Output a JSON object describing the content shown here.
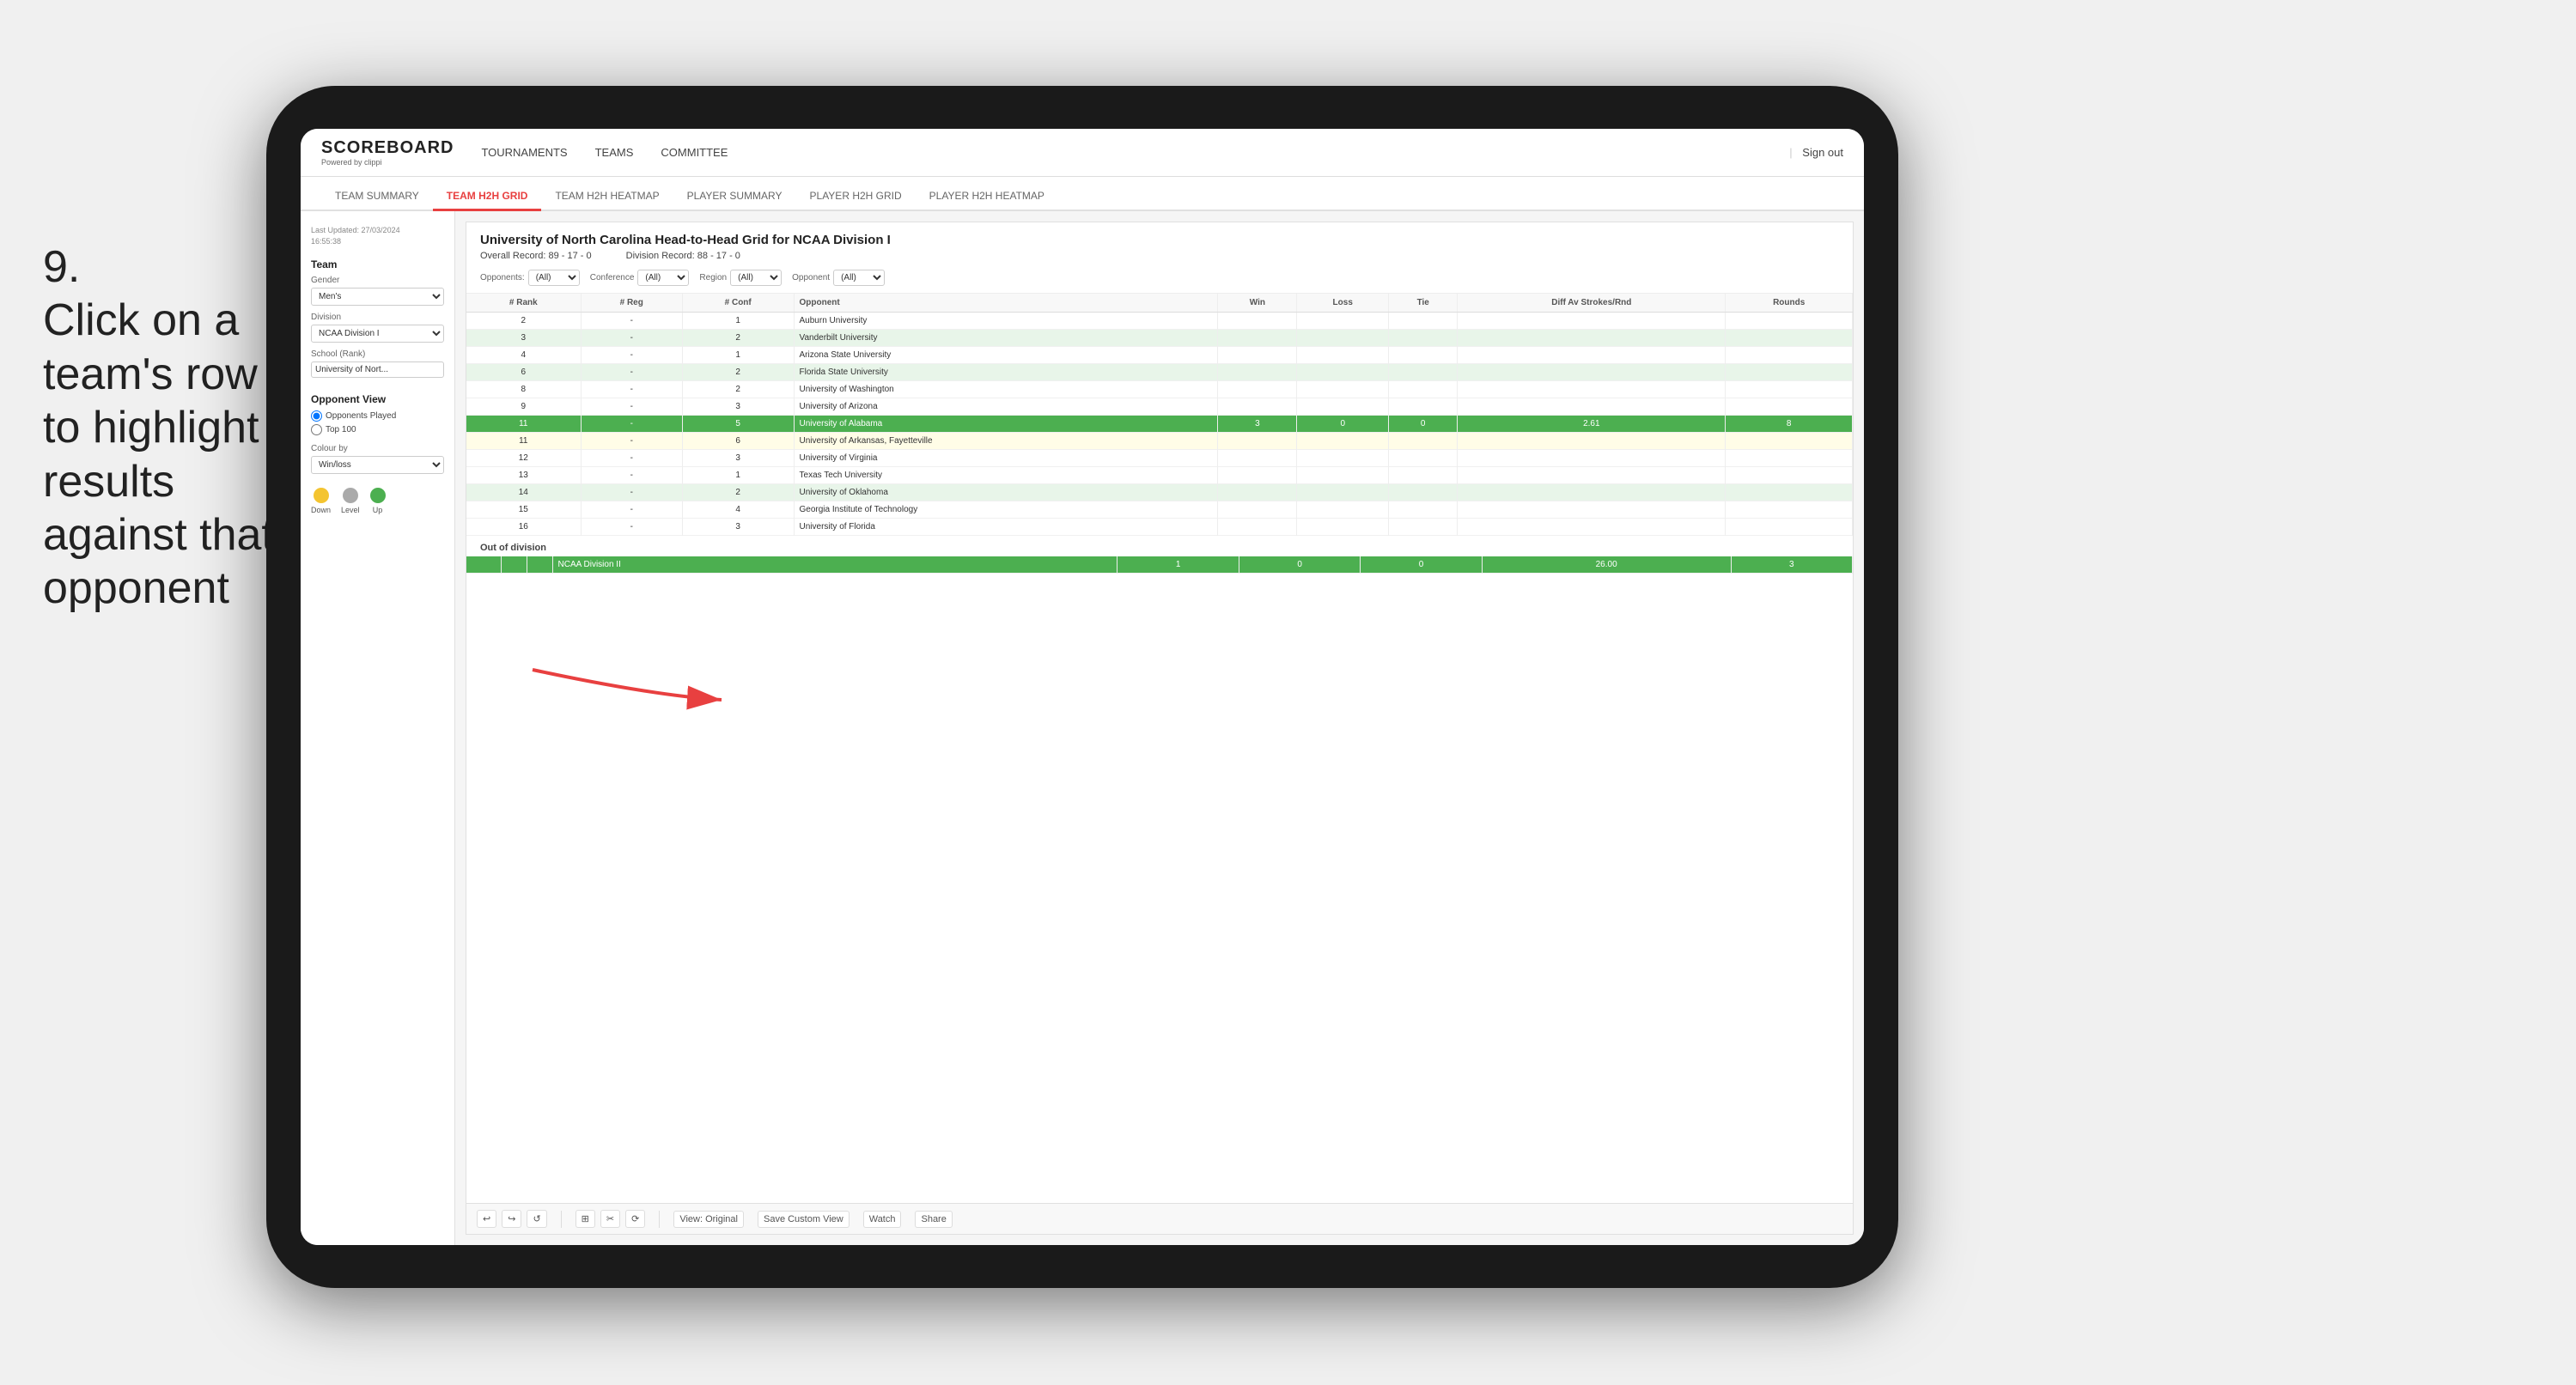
{
  "instruction": {
    "step": "9.",
    "text": "Click on a team's row to highlight results against that opponent"
  },
  "app": {
    "logo": {
      "title": "SCOREBOARD",
      "subtitle": "Powered by clippi"
    },
    "nav": {
      "links": [
        "TOURNAMENTS",
        "TEAMS",
        "COMMITTEE"
      ],
      "sign_out": "Sign out"
    },
    "subnav": {
      "tabs": [
        "TEAM SUMMARY",
        "TEAM H2H GRID",
        "TEAM H2H HEATMAP",
        "PLAYER SUMMARY",
        "PLAYER H2H GRID",
        "PLAYER H2H HEATMAP"
      ],
      "active": "TEAM H2H GRID"
    }
  },
  "sidebar": {
    "last_updated_label": "Last Updated: 27/03/2024",
    "time": "16:55:38",
    "team_label": "Team",
    "gender_label": "Gender",
    "gender_value": "Men's",
    "division_label": "Division",
    "division_value": "NCAA Division I",
    "school_label": "School (Rank)",
    "school_value": "University of Nort...",
    "opponent_view_label": "Opponent View",
    "radio_opponents": "Opponents Played",
    "radio_top100": "Top 100",
    "colour_by_label": "Colour by",
    "colour_by_value": "Win/loss",
    "legend": {
      "down_label": "Down",
      "level_label": "Level",
      "up_label": "Up",
      "down_color": "#f4c430",
      "level_color": "#aaa",
      "up_color": "#4caf50"
    }
  },
  "grid": {
    "title": "University of North Carolina Head-to-Head Grid for NCAA Division I",
    "overall_record_label": "Overall Record:",
    "overall_record": "89 - 17 - 0",
    "division_record_label": "Division Record:",
    "division_record": "88 - 17 - 0",
    "filters": {
      "opponents_label": "Opponents:",
      "opponents_value": "(All)",
      "conference_label": "Conference",
      "conference_value": "(All)",
      "region_label": "Region",
      "region_value": "(All)",
      "opponent_label": "Opponent",
      "opponent_value": "(All)"
    },
    "columns": [
      "# Rank",
      "# Reg",
      "# Conf",
      "Opponent",
      "Win",
      "Loss",
      "Tie",
      "Diff Av Strokes/Rnd",
      "Rounds"
    ],
    "rows": [
      {
        "rank": "2",
        "reg": "-",
        "conf": "1",
        "opponent": "Auburn University",
        "win": "",
        "loss": "",
        "tie": "",
        "diff": "",
        "rounds": "",
        "style": ""
      },
      {
        "rank": "3",
        "reg": "-",
        "conf": "2",
        "opponent": "Vanderbilt University",
        "win": "",
        "loss": "",
        "tie": "",
        "diff": "",
        "rounds": "",
        "style": "light-green"
      },
      {
        "rank": "4",
        "reg": "-",
        "conf": "1",
        "opponent": "Arizona State University",
        "win": "",
        "loss": "",
        "tie": "",
        "diff": "",
        "rounds": "",
        "style": ""
      },
      {
        "rank": "6",
        "reg": "-",
        "conf": "2",
        "opponent": "Florida State University",
        "win": "",
        "loss": "",
        "tie": "",
        "diff": "",
        "rounds": "",
        "style": "light-green"
      },
      {
        "rank": "8",
        "reg": "-",
        "conf": "2",
        "opponent": "University of Washington",
        "win": "",
        "loss": "",
        "tie": "",
        "diff": "",
        "rounds": "",
        "style": ""
      },
      {
        "rank": "9",
        "reg": "-",
        "conf": "3",
        "opponent": "University of Arizona",
        "win": "",
        "loss": "",
        "tie": "",
        "diff": "",
        "rounds": "",
        "style": ""
      },
      {
        "rank": "11",
        "reg": "-",
        "conf": "5",
        "opponent": "University of Alabama",
        "win": "3",
        "loss": "0",
        "tie": "0",
        "diff": "2.61",
        "rounds": "8",
        "style": "highlighted"
      },
      {
        "rank": "11",
        "reg": "-",
        "conf": "6",
        "opponent": "University of Arkansas, Fayetteville",
        "win": "",
        "loss": "",
        "tie": "",
        "diff": "",
        "rounds": "",
        "style": "light-yellow"
      },
      {
        "rank": "12",
        "reg": "-",
        "conf": "3",
        "opponent": "University of Virginia",
        "win": "",
        "loss": "",
        "tie": "",
        "diff": "",
        "rounds": "",
        "style": ""
      },
      {
        "rank": "13",
        "reg": "-",
        "conf": "1",
        "opponent": "Texas Tech University",
        "win": "",
        "loss": "",
        "tie": "",
        "diff": "",
        "rounds": "",
        "style": ""
      },
      {
        "rank": "14",
        "reg": "-",
        "conf": "2",
        "opponent": "University of Oklahoma",
        "win": "",
        "loss": "",
        "tie": "",
        "diff": "",
        "rounds": "",
        "style": "light-green"
      },
      {
        "rank": "15",
        "reg": "-",
        "conf": "4",
        "opponent": "Georgia Institute of Technology",
        "win": "",
        "loss": "",
        "tie": "",
        "diff": "",
        "rounds": "",
        "style": ""
      },
      {
        "rank": "16",
        "reg": "-",
        "conf": "3",
        "opponent": "University of Florida",
        "win": "",
        "loss": "",
        "tie": "",
        "diff": "",
        "rounds": "",
        "style": ""
      }
    ],
    "out_of_division_label": "Out of division",
    "out_of_division_row": {
      "name": "NCAA Division II",
      "win": "1",
      "loss": "0",
      "tie": "0",
      "diff": "26.00",
      "rounds": "3"
    }
  },
  "toolbar": {
    "view_label": "View: Original",
    "save_label": "Save Custom View",
    "watch_label": "Watch",
    "share_label": "Share"
  }
}
